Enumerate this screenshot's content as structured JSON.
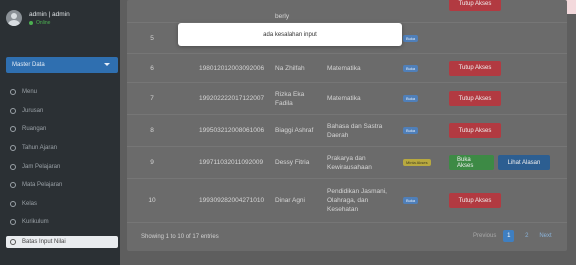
{
  "user": {
    "name": "admin | admin",
    "status": "Online"
  },
  "sidebar": {
    "section": "Master Data",
    "items": [
      {
        "label": "Menu"
      },
      {
        "label": "Jurusan"
      },
      {
        "label": "Ruangan"
      },
      {
        "label": "Tahun Ajaran"
      },
      {
        "label": "Jam Pelajaran"
      },
      {
        "label": "Mata Pelajaran"
      },
      {
        "label": "Kelas"
      },
      {
        "label": "Kurikulum"
      },
      {
        "label": "Batas Input Nilai"
      }
    ]
  },
  "modal": {
    "message": "ada kesalahan input"
  },
  "table": {
    "top_partial_name": "berly",
    "top_partial_button": "Tutup Akses",
    "rows": [
      {
        "no": "5",
        "nip": "",
        "nama": "",
        "mapel": "",
        "badge": "Buka",
        "actions": []
      },
      {
        "no": "6",
        "nip": "198012012003092006",
        "nama": "Na Zhilfah",
        "mapel": "Matematika",
        "badge": "Buka",
        "actions": [
          "Tutup Akses"
        ]
      },
      {
        "no": "7",
        "nip": "199202222017122007",
        "nama": "Rizka Eka Fadila",
        "mapel": "Matematika",
        "badge": "Buka",
        "actions": [
          "Tutup Akses"
        ]
      },
      {
        "no": "8",
        "nip": "199503212008061006",
        "nama": "Biaggi Ashraf",
        "mapel": "Bahasa dan Sastra Daerah",
        "badge": "Buka",
        "actions": [
          "Tutup Akses"
        ]
      },
      {
        "no": "9",
        "nip": "199711032011092009",
        "nama": "Dessy Fitria",
        "mapel": "Prakarya dan Kewirausahaan",
        "badge": "Minta Akses",
        "actions": [
          "Buka Akses",
          "Lihat Alasan"
        ]
      },
      {
        "no": "10",
        "nip": "199309282004271010",
        "nama": "Dinar Agni",
        "mapel": "Pendidikan Jasmani, Olahraga, dan Kesehatan",
        "badge": "Buka",
        "actions": [
          "Tutup Akses"
        ]
      }
    ]
  },
  "footer": {
    "info": "Showing 1 to 10 of 17 entries",
    "previous": "Previous",
    "page1": "1",
    "page2": "2",
    "next": "Next"
  }
}
